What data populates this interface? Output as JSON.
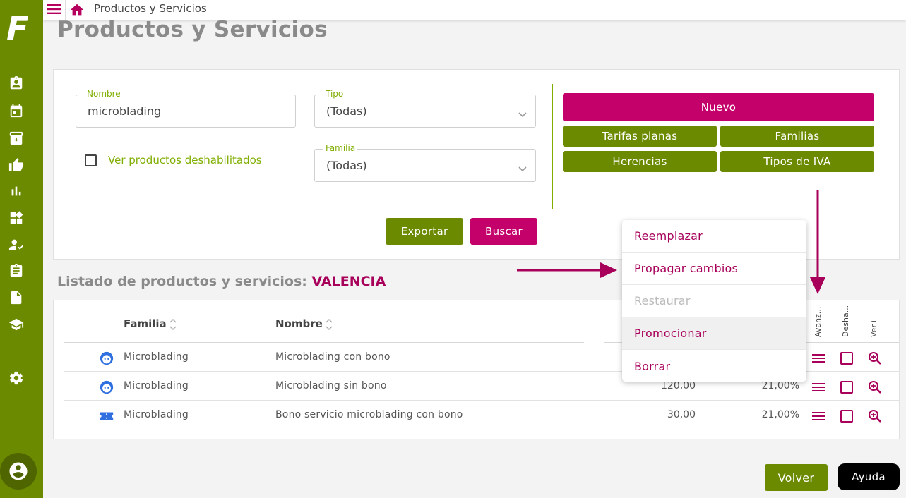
{
  "app": {
    "logo": "F",
    "breadcrumb": "Productos y Servicios",
    "page_title": "Productos y Servicios"
  },
  "sidebar": {
    "icons": [
      "clipboard-user-icon",
      "calendar-icon",
      "archive-box-icon",
      "thumbs-up-icon",
      "bar-chart-icon",
      "widgets-icon",
      "person-check-icon",
      "list-clipboard-icon",
      "document-icon",
      "graduation-cap-icon",
      "gear-icon",
      "user-avatar-icon"
    ]
  },
  "filters": {
    "nombre": {
      "label": "Nombre",
      "value": "microblading"
    },
    "tipo": {
      "label": "Tipo",
      "value": "(Todas)"
    },
    "familia": {
      "label": "Familia",
      "value": "(Todas)"
    },
    "ver_deshabilitados": {
      "label": "Ver productos deshabilitados",
      "checked": false
    },
    "exportar_label": "Exportar",
    "buscar_label": "Buscar"
  },
  "actions": {
    "nuevo": "Nuevo",
    "tarifas_planas": "Tarifas planas",
    "familias": "Familias",
    "herencias": "Herencias",
    "tipos_iva": "Tipos de IVA"
  },
  "list": {
    "title": "Listado de productos y servicios:",
    "city": "VALENCIA",
    "headers": {
      "familia": "Familia",
      "nombre": "Nombre",
      "avanzado": "Avanz...",
      "deshabilitado": "Desha...",
      "ver": "Ver+"
    },
    "rows": [
      {
        "icon": "face-icon",
        "familia": "Microblading",
        "nombre": "Microblading con bono",
        "precio": "",
        "iva": ""
      },
      {
        "icon": "face-icon",
        "familia": "Microblading",
        "nombre": "Microblading sin bono",
        "precio": "120,00",
        "iva": "21,00%"
      },
      {
        "icon": "ticket-icon",
        "familia": "Microblading",
        "nombre": "Bono servicio microblading con bono",
        "precio": "30,00",
        "iva": "21,00%"
      }
    ]
  },
  "dropdown_menu": {
    "items": [
      {
        "label": "Reemplazar",
        "disabled": false
      },
      {
        "label": "Propagar cambios",
        "disabled": false
      },
      {
        "label": "Restaurar",
        "disabled": true
      },
      {
        "label": "Promocionar",
        "disabled": false
      },
      {
        "label": "Borrar",
        "disabled": false
      }
    ]
  },
  "footer": {
    "volver": "Volver",
    "ayuda": "Ayuda"
  },
  "colors": {
    "brand_green": "#6b8a00",
    "accent_magenta": "#c4006a",
    "label_green": "#7fae00",
    "face_icon_blue": "#2f6fe0"
  }
}
